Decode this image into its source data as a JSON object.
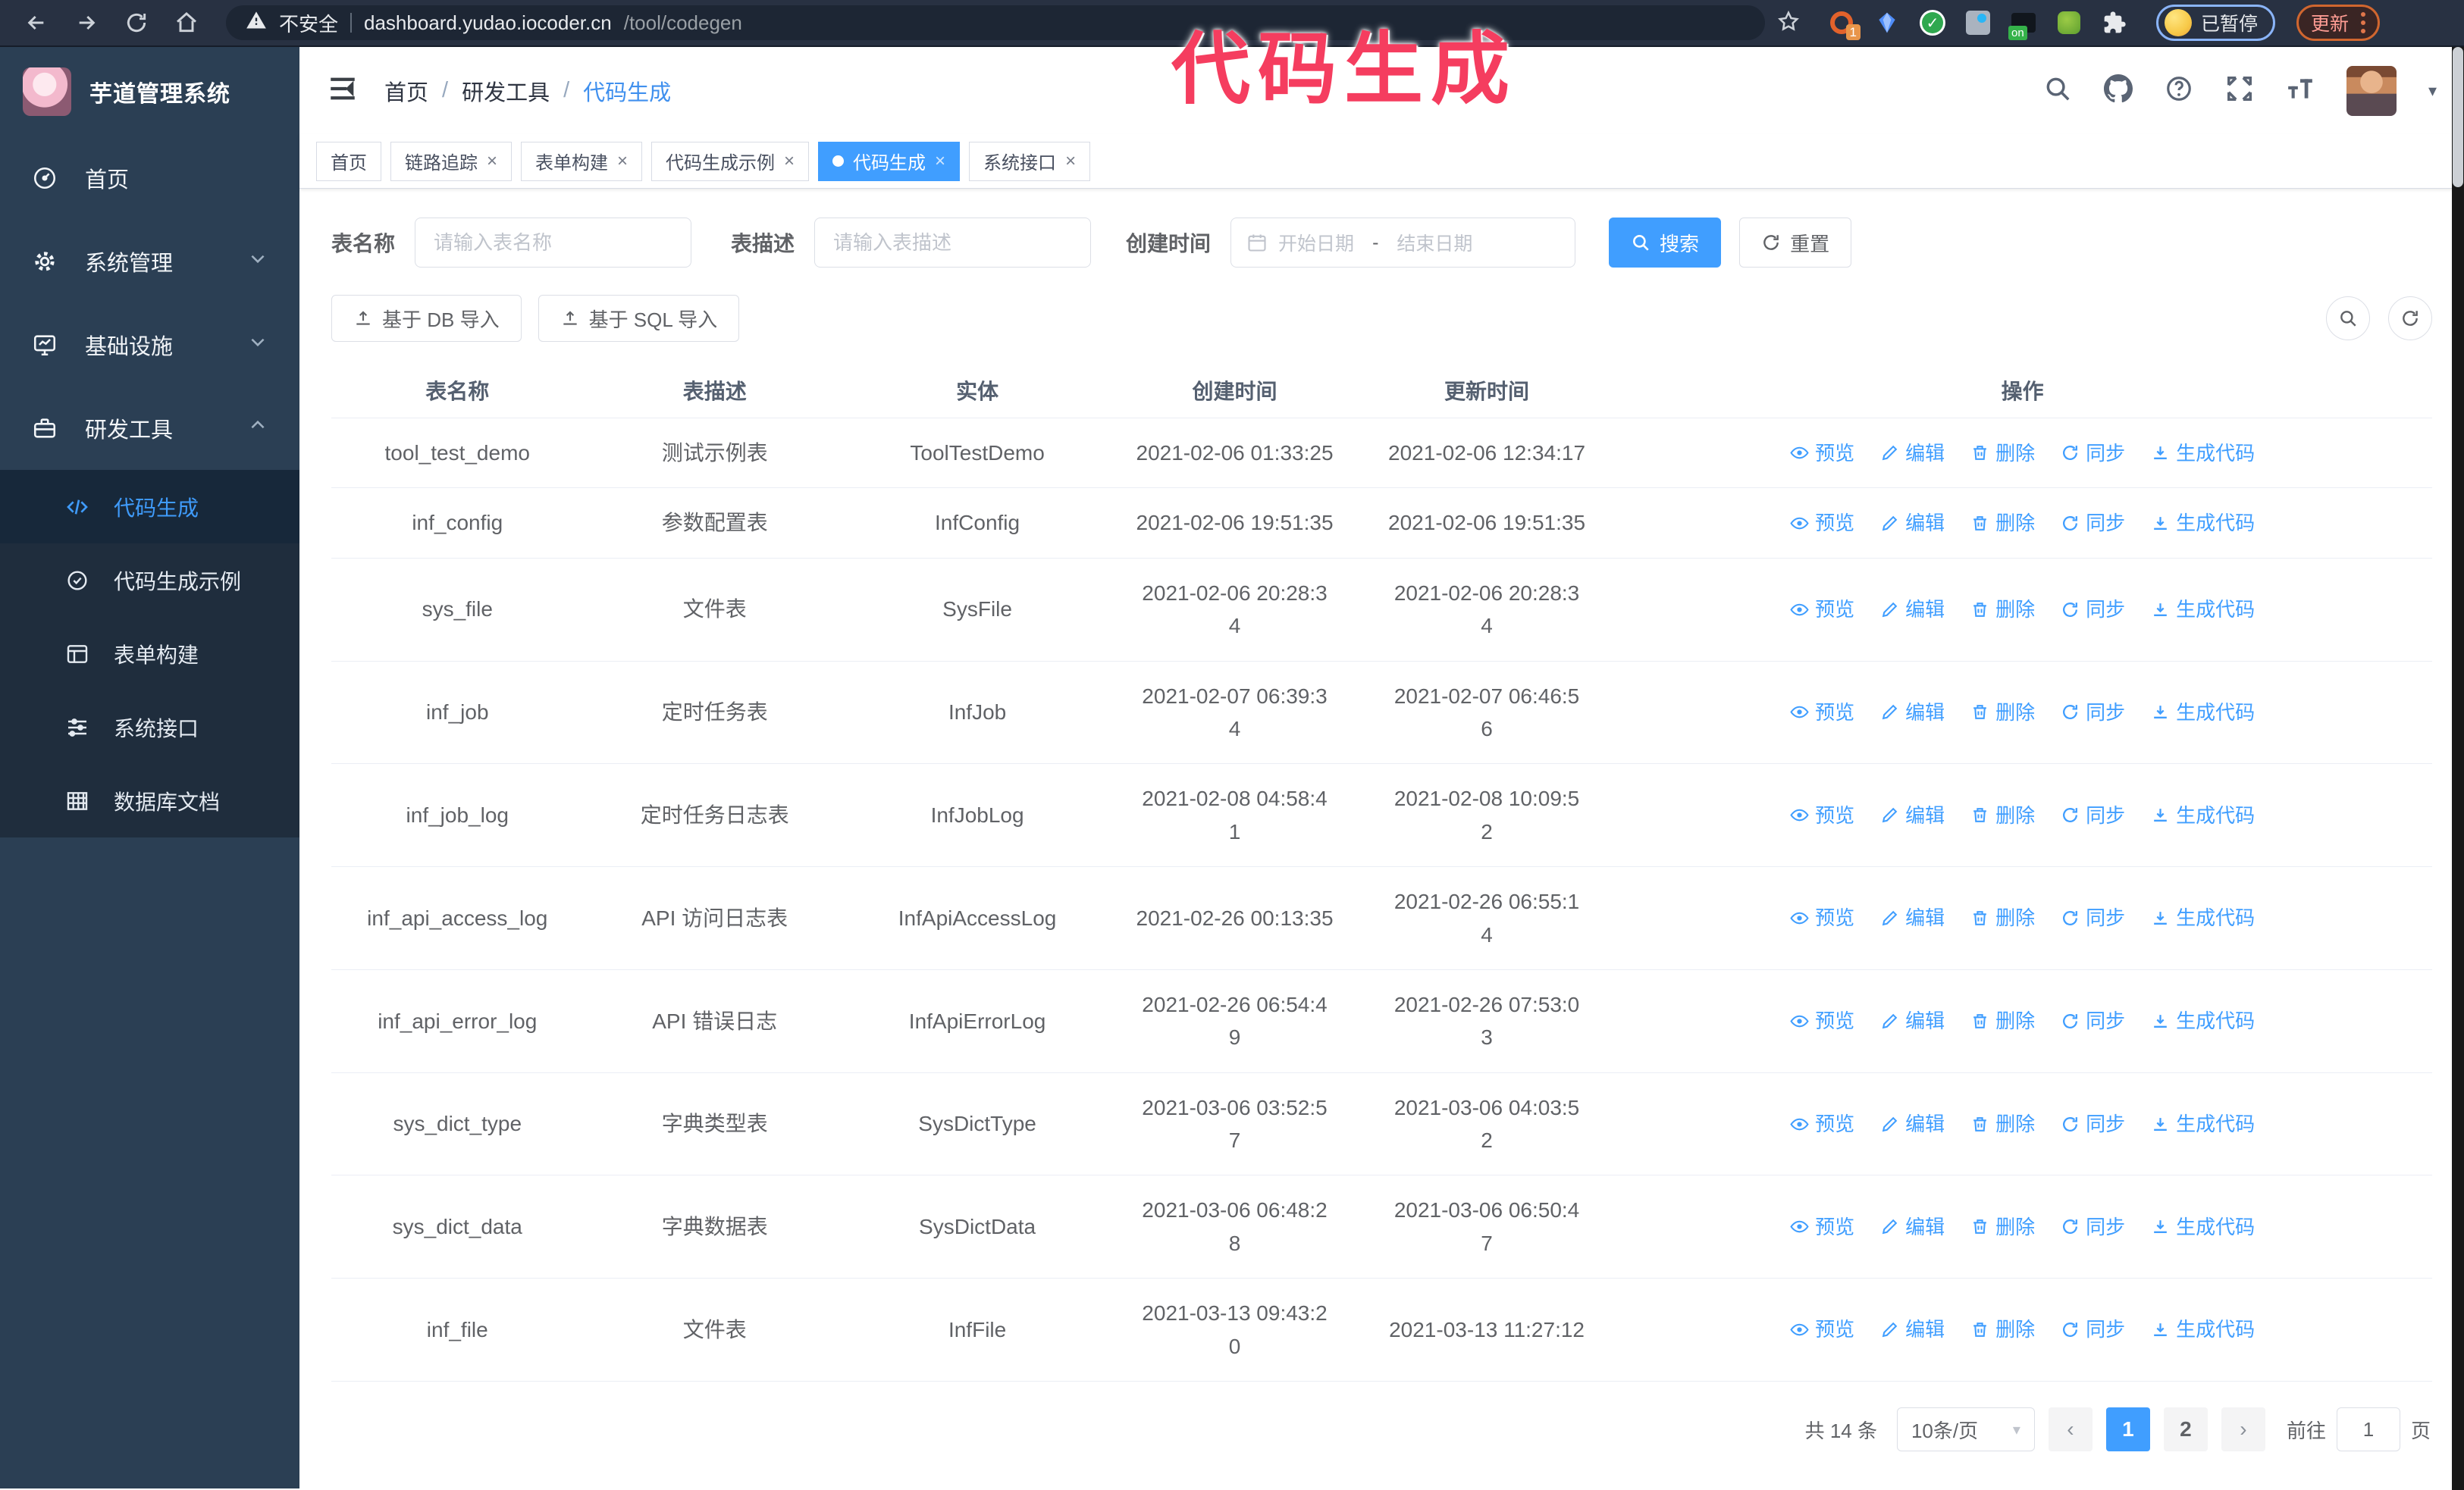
{
  "browser": {
    "security_warning": "不安全",
    "url_host": "dashboard.yudao.iocoder.cn",
    "url_path": "/tool/codegen",
    "ext_badge_count": "1",
    "profile_badge": "已暂停",
    "update_button": "更新"
  },
  "overlay": {
    "title": "代码生成"
  },
  "sidebar": {
    "app_title": "芋道管理系统",
    "items": [
      {
        "label": "首页"
      },
      {
        "label": "系统管理"
      },
      {
        "label": "基础设施"
      },
      {
        "label": "研发工具"
      }
    ],
    "subitems": [
      {
        "label": "代码生成",
        "active": true
      },
      {
        "label": "代码生成示例",
        "active": false
      },
      {
        "label": "表单构建",
        "active": false
      },
      {
        "label": "系统接口",
        "active": false
      },
      {
        "label": "数据库文档",
        "active": false
      }
    ]
  },
  "header": {
    "breadcrumb": [
      "首页",
      "研发工具",
      "代码生成"
    ]
  },
  "tabs": [
    {
      "label": "首页",
      "closable": false,
      "active": false
    },
    {
      "label": "链路追踪",
      "closable": true,
      "active": false
    },
    {
      "label": "表单构建",
      "closable": true,
      "active": false
    },
    {
      "label": "代码生成示例",
      "closable": true,
      "active": false
    },
    {
      "label": "代码生成",
      "closable": true,
      "active": true
    },
    {
      "label": "系统接口",
      "closable": true,
      "active": false
    }
  ],
  "search": {
    "name_label": "表名称",
    "name_placeholder": "请输入表名称",
    "desc_label": "表描述",
    "desc_placeholder": "请输入表描述",
    "time_label": "创建时间",
    "start_placeholder": "开始日期",
    "range_separator": "-",
    "end_placeholder": "结束日期",
    "search_button": "搜索",
    "reset_button": "重置"
  },
  "toolbar": {
    "db_import": "基于 DB 导入",
    "sql_import": "基于 SQL 导入"
  },
  "table": {
    "headers": [
      "表名称",
      "表描述",
      "实体",
      "创建时间",
      "更新时间",
      "操作"
    ],
    "actions": [
      "预览",
      "编辑",
      "删除",
      "同步",
      "生成代码"
    ],
    "rows": [
      {
        "name": "tool_test_demo",
        "desc": "测试示例表",
        "entity": "ToolTestDemo",
        "created": "2021-02-06 01:33:25",
        "updated": "2021-02-06 12:34:17"
      },
      {
        "name": "inf_config",
        "desc": "参数配置表",
        "entity": "InfConfig",
        "created": "2021-02-06 19:51:35",
        "updated": "2021-02-06 19:51:35"
      },
      {
        "name": "sys_file",
        "desc": "文件表",
        "entity": "SysFile",
        "created": "2021-02-06 20:28:3\n4",
        "updated": "2021-02-06 20:28:3\n4"
      },
      {
        "name": "inf_job",
        "desc": "定时任务表",
        "entity": "InfJob",
        "created": "2021-02-07 06:39:3\n4",
        "updated": "2021-02-07 06:46:5\n6"
      },
      {
        "name": "inf_job_log",
        "desc": "定时任务日志表",
        "entity": "InfJobLog",
        "created": "2021-02-08 04:58:4\n1",
        "updated": "2021-02-08 10:09:5\n2"
      },
      {
        "name": "inf_api_access_log",
        "desc": "API 访问日志表",
        "entity": "InfApiAccessLog",
        "created": "2021-02-26 00:13:35",
        "updated": "2021-02-26 06:55:1\n4"
      },
      {
        "name": "inf_api_error_log",
        "desc": "API 错误日志",
        "entity": "InfApiErrorLog",
        "created": "2021-02-26 06:54:4\n9",
        "updated": "2021-02-26 07:53:0\n3"
      },
      {
        "name": "sys_dict_type",
        "desc": "字典类型表",
        "entity": "SysDictType",
        "created": "2021-03-06 03:52:5\n7",
        "updated": "2021-03-06 04:03:5\n2"
      },
      {
        "name": "sys_dict_data",
        "desc": "字典数据表",
        "entity": "SysDictData",
        "created": "2021-03-06 06:48:2\n8",
        "updated": "2021-03-06 06:50:4\n7"
      },
      {
        "name": "inf_file",
        "desc": "文件表",
        "entity": "InfFile",
        "created": "2021-03-13 09:43:2\n0",
        "updated": "2021-03-13 11:27:12"
      }
    ]
  },
  "pagination": {
    "total": "共 14 条",
    "page_size": "10条/页",
    "pages": [
      "1",
      "2"
    ],
    "active_page": "1",
    "goto_label": "前往",
    "goto_value": "1",
    "page_label": "页"
  },
  "colors": {
    "accent": "#409eff",
    "sidebar_bg": "#2b3f54",
    "submenu_bg": "#1f2d3d",
    "annotation_pink": "#f53d5f"
  }
}
